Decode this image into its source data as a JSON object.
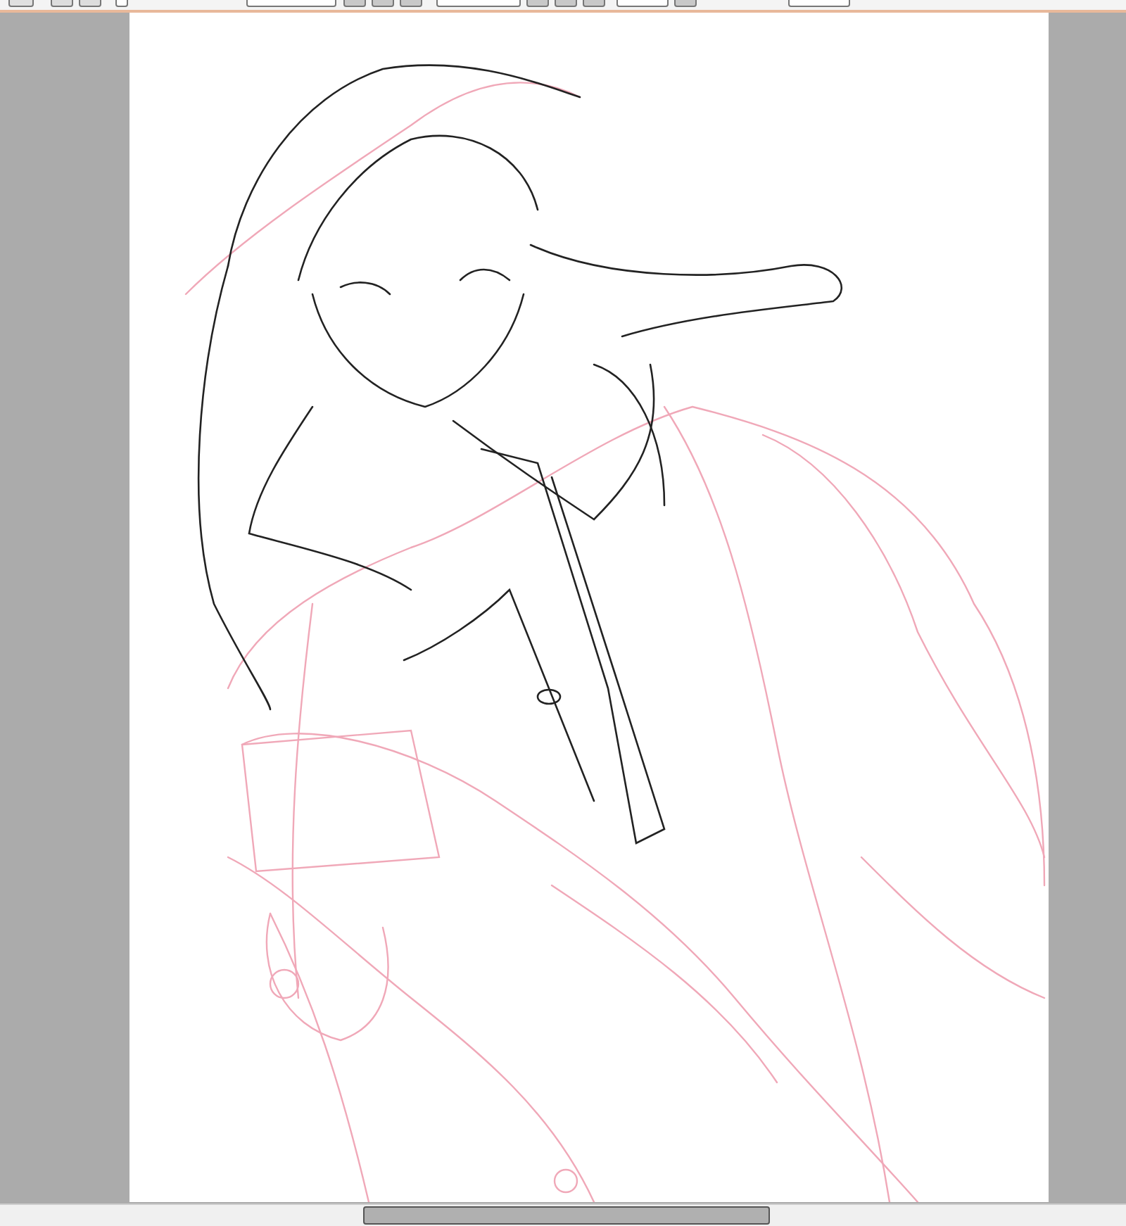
{
  "toolbar": {
    "checkbox": {
      "checked": false
    }
  }
}
